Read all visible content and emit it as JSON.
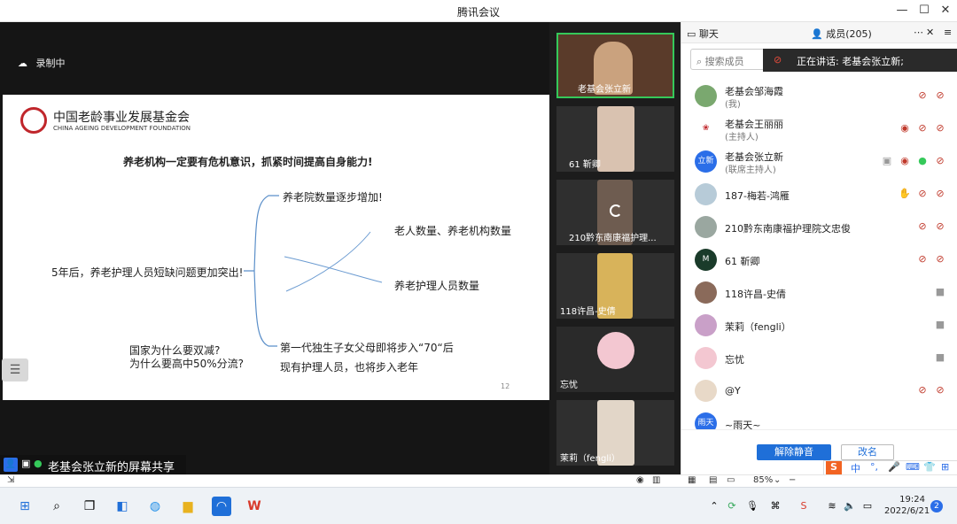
{
  "window": {
    "title": "腾讯会议"
  },
  "share": {
    "recording": "录制中",
    "sharer_label": "老基会张立新的屏幕共享",
    "slide": {
      "org_cn": "中国老龄事业发展基金会",
      "org_en": "CHINA AGEING DEVELOPMENT FOUNDATION",
      "headline": "养老机构一定要有危机意识，抓紧时间提高自身能力!",
      "left_point": "5年后，养老护理人员短缺问题更加突出!",
      "branch1": "养老院数量逐步增加!",
      "branch2a": "老人数量、养老机构数量",
      "branch2b": "养老护理人员数量",
      "branch3a": "第一代独生子女父母即将步入“70“后",
      "branch3b": "现有护理人员，也将步入老年",
      "question1": "国家为什么要双减?",
      "question2": "为什么要高中50%分流?",
      "page": "12"
    }
  },
  "tiles": [
    {
      "name": "老基会张立新"
    },
    {
      "name": "61 靳卿"
    },
    {
      "name": "210黔东南康福护理..."
    },
    {
      "name": "118许昌-史倩"
    },
    {
      "name": "忘忧"
    },
    {
      "name": "茉莉（fengli）"
    }
  ],
  "panel": {
    "tab_chat": "聊天",
    "tab_members": "成员(205)",
    "search_placeholder": "搜索成员",
    "speaking": "正在讲话: 老基会张立新;",
    "members": [
      {
        "name": "老基会邹海霞",
        "role": "(我)",
        "avatar": ""
      },
      {
        "name": "老基会王丽丽",
        "role": "(主持人)",
        "avatar": ""
      },
      {
        "name": "老基会张立新",
        "role": "(联席主持人)",
        "avatar": "立新"
      },
      {
        "name": "187-梅若-鸿雁",
        "role": "",
        "avatar": ""
      },
      {
        "name": "210黔东南康福护理院文忠俊",
        "role": "",
        "avatar": ""
      },
      {
        "name": "61 靳卿",
        "role": "",
        "avatar": ""
      },
      {
        "name": "118许昌-史倩",
        "role": "",
        "avatar": ""
      },
      {
        "name": "茉莉（fengli）",
        "role": "",
        "avatar": ""
      },
      {
        "name": "忘忧",
        "role": "",
        "avatar": ""
      },
      {
        "name": "@Y",
        "role": "",
        "avatar": ""
      },
      {
        "name": "~雨天~",
        "role": "",
        "avatar": "雨天"
      }
    ],
    "unmute_all": "解除静音",
    "rename": "改名"
  },
  "status": {
    "zoom": "85%",
    "ime": "中"
  },
  "taskbar": {
    "time": "19:24",
    "date": "2022/6/21",
    "notifications": "2"
  }
}
